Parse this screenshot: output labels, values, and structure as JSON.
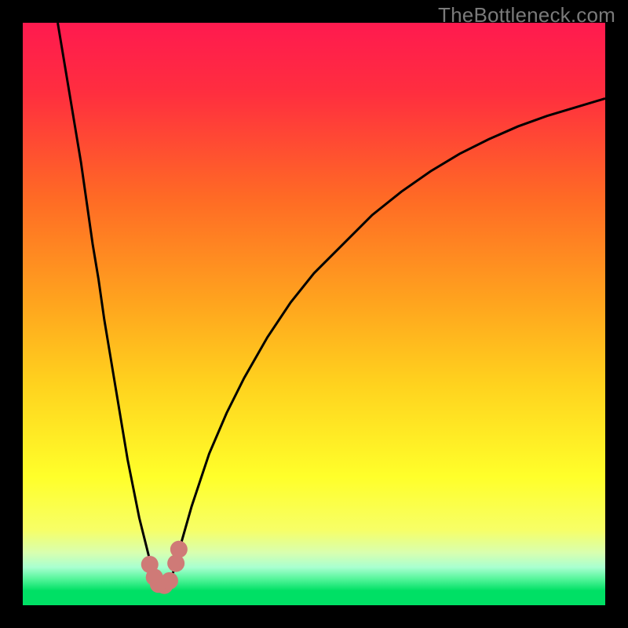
{
  "watermark": "TheBottleneck.com",
  "colors": {
    "frame": "#000000",
    "watermark": "#7a7a7a",
    "curve": "#000000",
    "marker": "#cf7a77",
    "bottom_band": "#00e065"
  },
  "chart_data": {
    "type": "line",
    "title": "",
    "xlabel": "",
    "ylabel": "",
    "xlim": [
      0,
      100
    ],
    "ylim": [
      0,
      100
    ],
    "gradient_stops": [
      {
        "pos": 0.0,
        "color": "#ff1a4f"
      },
      {
        "pos": 0.12,
        "color": "#ff2e3f"
      },
      {
        "pos": 0.3,
        "color": "#ff6a25"
      },
      {
        "pos": 0.48,
        "color": "#ffa41e"
      },
      {
        "pos": 0.62,
        "color": "#ffd21e"
      },
      {
        "pos": 0.78,
        "color": "#ffff2a"
      },
      {
        "pos": 0.87,
        "color": "#f7ff66"
      },
      {
        "pos": 0.91,
        "color": "#d8ffb0"
      },
      {
        "pos": 0.935,
        "color": "#a8ffd0"
      },
      {
        "pos": 0.955,
        "color": "#54f59a"
      },
      {
        "pos": 0.975,
        "color": "#00e065"
      },
      {
        "pos": 1.0,
        "color": "#00e065"
      }
    ],
    "series": [
      {
        "name": "left-branch",
        "x": [
          6,
          7,
          8,
          9,
          10,
          11,
          12,
          13,
          14,
          15,
          16,
          17,
          18,
          19,
          20,
          21,
          22,
          22.8
        ],
        "y": [
          100,
          94,
          88,
          82,
          76,
          69,
          62,
          56,
          49,
          43,
          37,
          31,
          25,
          20,
          15,
          11,
          7,
          4.5
        ]
      },
      {
        "name": "right-branch",
        "x": [
          25.5,
          27,
          29,
          32,
          35,
          38,
          42,
          46,
          50,
          55,
          60,
          65,
          70,
          75,
          80,
          85,
          90,
          95,
          100
        ],
        "y": [
          4.5,
          10,
          17,
          26,
          33,
          39,
          46,
          52,
          57,
          62,
          67,
          71,
          74.5,
          77.5,
          80,
          82.2,
          84,
          85.5,
          87
        ]
      }
    ],
    "markers": [
      {
        "x": 21.8,
        "y": 7.0
      },
      {
        "x": 22.6,
        "y": 4.8
      },
      {
        "x": 23.3,
        "y": 3.6
      },
      {
        "x": 24.3,
        "y": 3.4
      },
      {
        "x": 25.2,
        "y": 4.2
      },
      {
        "x": 26.3,
        "y": 7.2
      },
      {
        "x": 26.8,
        "y": 9.6
      }
    ]
  }
}
